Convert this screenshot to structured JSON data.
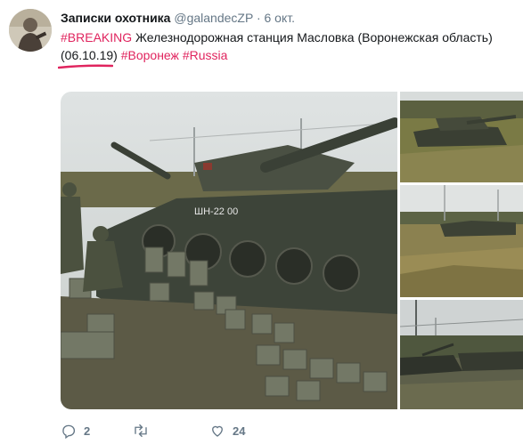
{
  "tweet": {
    "display_name": "Записки охотника",
    "handle": "@galandecZP",
    "separator": "·",
    "time": "6 окт.",
    "text": {
      "hashtag1": "#BREAKING",
      "body": " Железнодорожная станция Масловка (Воронежская область)",
      "date": "(06.10.19)",
      "hashtag2": "#Воронеж",
      "hashtag3": "#Russia"
    },
    "turret_marking": "ШН-22 00"
  },
  "actions": {
    "reply_count": "2",
    "retweet_count": "",
    "like_count": "24"
  },
  "colors": {
    "hashtag": "#e0245e",
    "underline": "#e0245e",
    "secondary_text": "#657786"
  }
}
